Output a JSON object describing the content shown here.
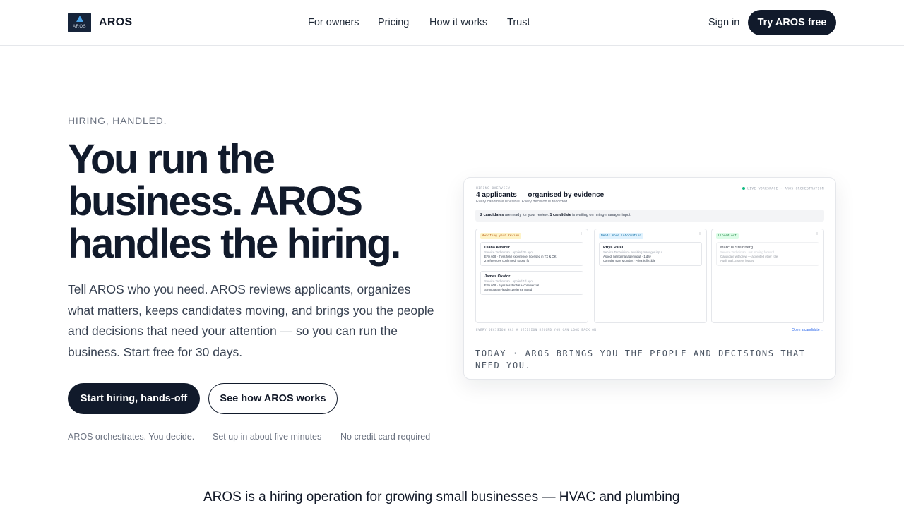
{
  "header": {
    "logo_text": "AROS",
    "brand": "AROS",
    "nav": [
      "For owners",
      "Pricing",
      "How it works",
      "Trust"
    ],
    "sign_in": "Sign in",
    "cta": "Try AROS free"
  },
  "hero": {
    "eyebrow": "HIRING, HANDLED.",
    "headline_lines": [
      "You run the",
      "business. AROS",
      "handles the hiring."
    ],
    "lede": "Tell AROS who you need. AROS reviews applicants, organizes what matters, keeps candidates moving, and brings you the people and decisions that need your attention — so you can run the business. Start free for 30 days.",
    "primary_cta": "Start hiring, hands-off",
    "secondary_cta": "See how AROS works",
    "proof": [
      "AROS orchestrates. You decide.",
      "Set up in about five minutes",
      "No credit card required"
    ]
  },
  "preview": {
    "overline": "HIRING OVERVIEW",
    "title": "4 applicants — organised by evidence",
    "subtitle": "Every candidate is visible. Every decision is recorded.",
    "live": "LIVE WORKSPACE · AROS ORCHESTRATION",
    "banner_bold_1": "2 candidates",
    "banner_text_1": " are ready for your review. ",
    "banner_bold_2": "1 candidate",
    "banner_text_2": " is waiting on hiring-manager input.",
    "columns": [
      {
        "label": "Awaiting your review",
        "chip_bg": "#fef3c7",
        "chip_fg": "#b45309",
        "cards": [
          {
            "name": "Diana Alvarez",
            "role": "Service Technician · applied 3h ago",
            "lines": [
              "EPA 608 · 7 yrs field experience, licensed in TX & OK",
              "2 references confirmed, strong fit"
            ]
          },
          {
            "name": "James Okafor",
            "role": "Service Technician · applied 1d ago",
            "lines": [
              "EPA 608 · 5 yrs residential + commercial",
              "Strong team-lead experience noted"
            ]
          }
        ]
      },
      {
        "label": "Needs more information",
        "chip_bg": "#e0f2fe",
        "chip_fg": "#0369a1",
        "cards": [
          {
            "name": "Priya Patel",
            "role": "Service Technician · awaiting manager input",
            "lines": [
              "Asked: hiring manager input · 1 day",
              "Can she start Monday? Priya is flexible"
            ]
          }
        ]
      },
      {
        "label": "Closed out",
        "chip_bg": "#dcfce7",
        "chip_fg": "#15803d",
        "cards": [
          {
            "name": "Marcus Steinberg",
            "role": "Service Technician · not moving forward",
            "lines": [
              "Candidate withdrew — accepted other role",
              "Audit trail: 3 steps logged"
            ]
          }
        ]
      }
    ],
    "footer": "EVERY DECISION HAS A DECISION RECORD YOU CAN LOOK BACK ON.",
    "open_link": "Open a candidate →",
    "caption": "TODAY · AROS BRINGS YOU THE PEOPLE AND DECISIONS THAT NEED YOU."
  },
  "tagline": "AROS is a hiring operation for growing small businesses — HVAC and plumbing"
}
